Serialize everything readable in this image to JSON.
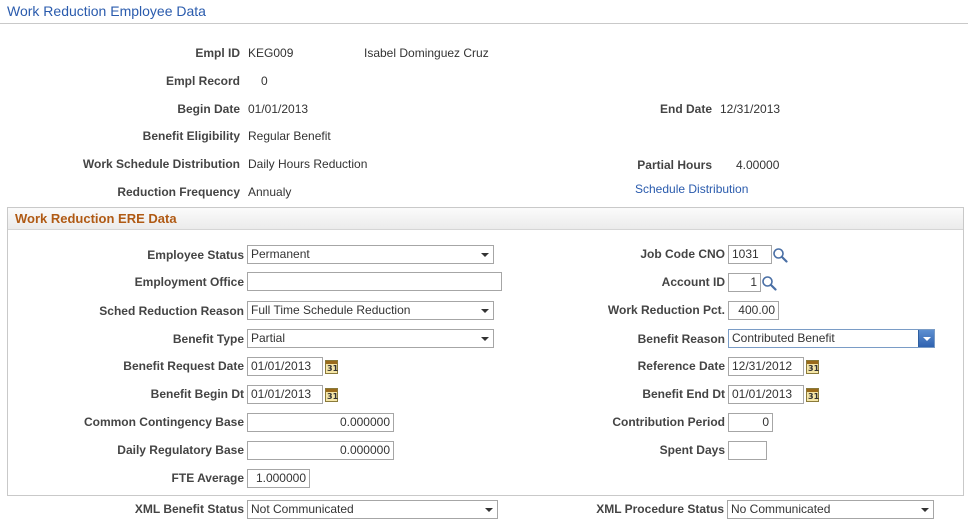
{
  "page": {
    "title": "Work Reduction Employee Data"
  },
  "header": {
    "empl_id_label": "Empl ID",
    "empl_id": "KEG009",
    "employee_name": "Isabel Dominguez Cruz",
    "empl_record_label": "Empl Record",
    "empl_record": "0",
    "begin_date_label": "Begin Date",
    "begin_date": "01/01/2013",
    "end_date_label": "End Date",
    "end_date": "12/31/2013",
    "benefit_eligibility_label": "Benefit Eligibility",
    "benefit_eligibility": "Regular Benefit",
    "work_schedule_label": "Work Schedule Distribution",
    "work_schedule": "Daily Hours Reduction",
    "partial_hours_label": "Partial Hours",
    "partial_hours": "4.00000",
    "reduction_frequency_label": "Reduction Frequency",
    "reduction_frequency": "Annualy",
    "schedule_distribution_link": "Schedule Distribution"
  },
  "section": {
    "title": "Work Reduction ERE Data",
    "employee_status_label": "Employee Status",
    "employee_status": "Permanent",
    "job_code_label": "Job Code CNO",
    "job_code": "1031",
    "employment_office_label": "Employment Office",
    "employment_office": "",
    "account_id_label": "Account ID",
    "account_id": "1",
    "sched_reduction_label": "Sched Reduction Reason",
    "sched_reduction": "Full Time Schedule Reduction",
    "work_reduction_pct_label": "Work Reduction Pct.",
    "work_reduction_pct": "400.00",
    "benefit_type_label": "Benefit Type",
    "benefit_type": "Partial",
    "benefit_reason_label": "Benefit Reason",
    "benefit_reason": "Contributed Benefit",
    "benefit_request_date_label": "Benefit Request Date",
    "benefit_request_date": "01/01/2013",
    "reference_date_label": "Reference Date",
    "reference_date": "12/31/2012",
    "benefit_begin_label": "Benefit Begin Dt",
    "benefit_begin": "01/01/2013",
    "benefit_end_label": "Benefit End Dt",
    "benefit_end": "01/01/2013",
    "common_contingency_label": "Common Contingency Base",
    "common_contingency": "0.000000",
    "contribution_period_label": "Contribution Period",
    "contribution_period": "0",
    "daily_regulatory_label": "Daily Regulatory Base",
    "daily_regulatory": "0.000000",
    "spent_days_label": "Spent Days",
    "spent_days": "",
    "fte_average_label": "FTE Average",
    "fte_average": "1.000000"
  },
  "footer": {
    "xml_benefit_status_label": "XML Benefit Status",
    "xml_benefit_status": "Not Communicated",
    "xml_procedure_status_label": "XML Procedure Status",
    "xml_procedure_status": "No Communicated"
  },
  "icons": {
    "lookup": "search-icon",
    "calendar": "calendar-icon",
    "calendar_day": "31"
  },
  "colors": {
    "title": "#2a5bad",
    "section_title": "#b05a14",
    "link": "#2a5bad"
  }
}
